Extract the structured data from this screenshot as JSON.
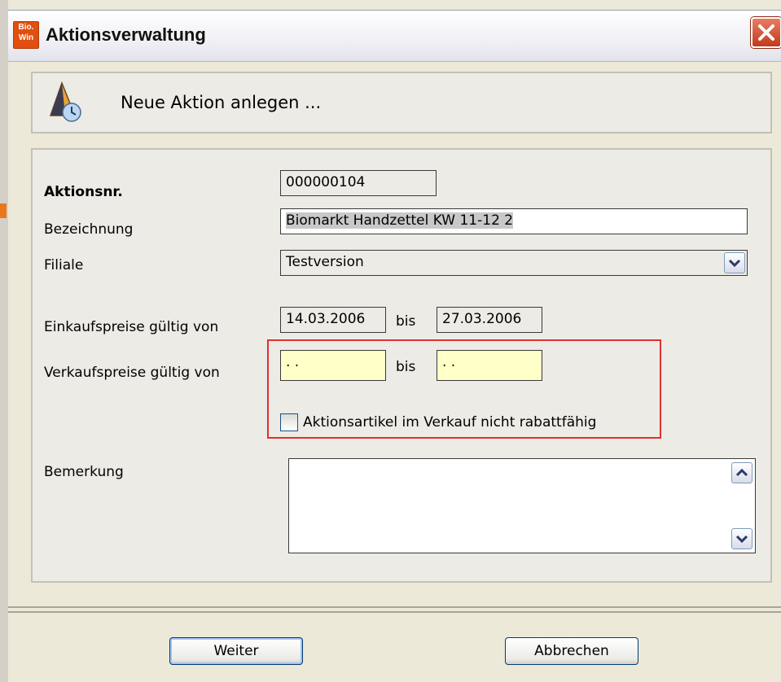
{
  "window": {
    "title": "Aktionsverwaltung",
    "icon_text": [
      "Bio.",
      "Win"
    ],
    "close_icon": "close-icon"
  },
  "header": {
    "text": "Neue Aktion anlegen ...",
    "icon": "campaign-clock-icon"
  },
  "form": {
    "aktionsnr": {
      "label": "Aktionsnr.",
      "value": "000000104"
    },
    "bezeichnung": {
      "label": "Bezeichnung",
      "value": "Biomarkt Handzettel KW 11-12 2"
    },
    "filiale": {
      "label": "Filiale",
      "value": "Testversion"
    },
    "einkauf": {
      "label": "Einkaufspreise gültig von",
      "from": "14.03.2006",
      "bis": "bis",
      "to": "27.03.2006"
    },
    "verkauf": {
      "label": "Verkaufspreise gültig von",
      "from": " .  .",
      "bis": "bis",
      "to": " .  ."
    },
    "checkbox": {
      "label": "Aktionsartikel im Verkauf nicht rabattfähig",
      "checked": false
    },
    "bemerkung": {
      "label": "Bemerkung",
      "value": ""
    }
  },
  "buttons": {
    "weiter": "Weiter",
    "abbrechen": "Abbrechen"
  },
  "colors": {
    "highlight_frame": "#e03030",
    "date_field_bg": "#ffffc8",
    "button_border": "#003c74"
  }
}
